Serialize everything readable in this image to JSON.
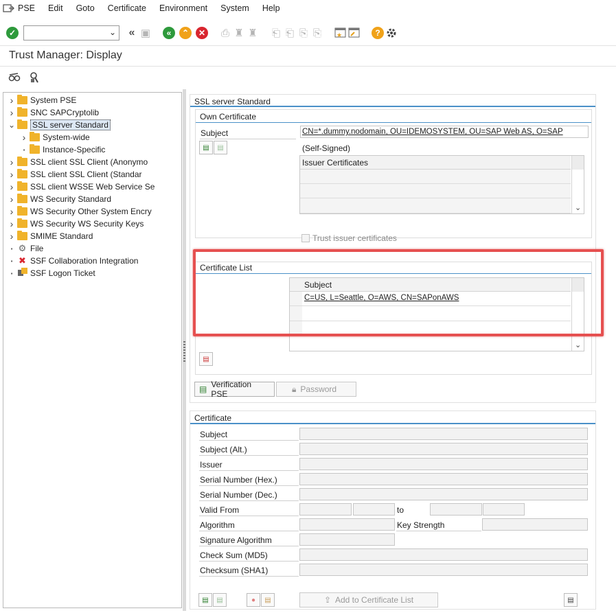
{
  "menu": {
    "items": [
      "PSE",
      "Edit",
      "Goto",
      "Certificate",
      "Environment",
      "System",
      "Help"
    ]
  },
  "toolbar": {
    "command_value": "",
    "icons": [
      "enter-icon",
      "back-icon",
      "exit-icon",
      "cancel-icon",
      "help-icon",
      "settings-icon"
    ]
  },
  "page": {
    "title": "Trust Manager: Display"
  },
  "tree": {
    "items": [
      {
        "label": "System PSE",
        "type": "folder",
        "expanded": false
      },
      {
        "label": "SNC SAPCryptolib",
        "type": "folder",
        "expanded": false
      },
      {
        "label": "SSL server Standard",
        "type": "folder",
        "expanded": true,
        "selected": true
      },
      {
        "label": "System-wide",
        "type": "folder",
        "child": true,
        "expanded": false
      },
      {
        "label": "Instance-Specific",
        "type": "folder",
        "child": true,
        "leaf": true
      },
      {
        "label": "SSL client SSL Client (Anonymo",
        "type": "folder"
      },
      {
        "label": "SSL client SSL Client (Standar",
        "type": "folder"
      },
      {
        "label": "SSL client WSSE Web Service Se",
        "type": "folder"
      },
      {
        "label": "WS Security Standard",
        "type": "folder"
      },
      {
        "label": "WS Security Other System Encry",
        "type": "folder"
      },
      {
        "label": "WS Security WS Security Keys",
        "type": "folder"
      },
      {
        "label": "SMIME Standard",
        "type": "folder"
      },
      {
        "label": "File",
        "type": "gear"
      },
      {
        "label": "SSF Collaboration Integration",
        "type": "cross"
      },
      {
        "label": "SSF Logon Ticket",
        "type": "ticket"
      }
    ]
  },
  "pse_panel": {
    "title": "SSL server Standard",
    "own_certificate": {
      "title": "Own Certificate",
      "subject_label": "Subject",
      "subject_value": "CN=*.dummy.nodomain, OU=IDEMOSYSTEM, OU=SAP Web AS, O=SAP",
      "self_signed": "(Self-Signed)",
      "issuer_header": "Issuer Certificates",
      "trust_issuer_label": "Trust issuer certificates"
    },
    "certificate_list": {
      "title": "Certificate List",
      "header": "Subject",
      "rows": [
        "C=US, L=Seattle, O=AWS, CN=SAPonAWS"
      ]
    },
    "verification_button": "Verification PSE",
    "password_button": "Password"
  },
  "certificate_panel": {
    "title": "Certificate",
    "labels": {
      "subject": "Subject",
      "subject_alt": "Subject (Alt.)",
      "issuer": "Issuer",
      "serial_hex": "Serial Number (Hex.)",
      "serial_dec": "Serial Number (Dec.)",
      "valid_from": "Valid From",
      "to": "to",
      "algorithm": "Algorithm",
      "key_strength": "Key Strength",
      "signature_algorithm": "Signature Algorithm",
      "checksum_md5": "Check Sum (MD5)",
      "checksum_sha1": "Checksum (SHA1)"
    },
    "add_button": "Add to Certificate List"
  },
  "colors": {
    "accent_line": "#4a90c8",
    "highlight": "#e65050",
    "folder": "#f0b32b"
  }
}
